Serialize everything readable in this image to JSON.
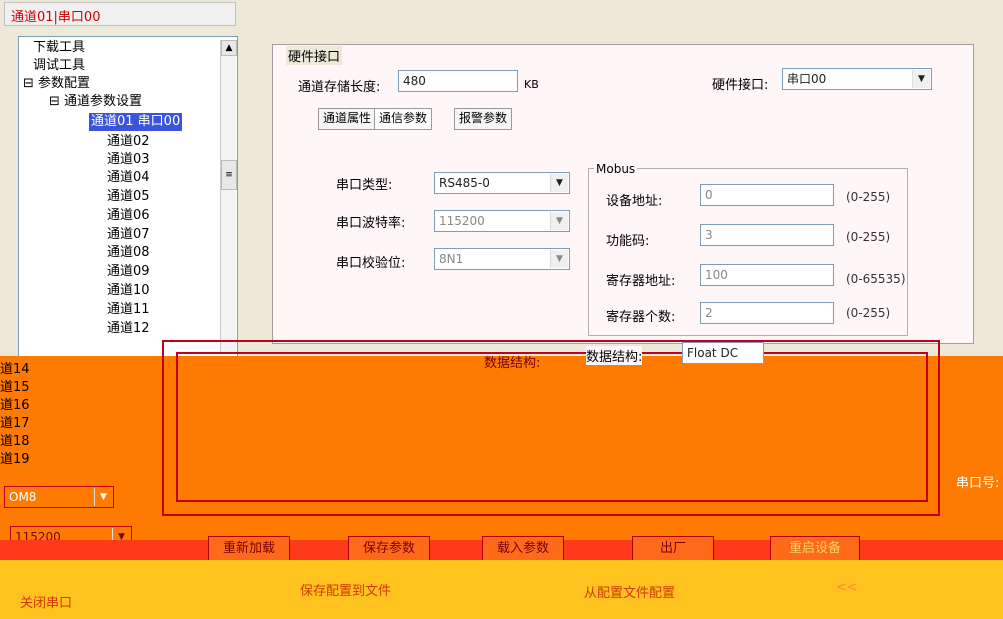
{
  "channel_title": "通道01|串口00",
  "tree": {
    "items": [
      "下载工具",
      "调试工具",
      "参数配置",
      "通道参数设置",
      "通道01 串口00",
      "通道02",
      "通道03",
      "通道04",
      "通道05",
      "通道06",
      "通道07",
      "通道08",
      "通道09",
      "通道10",
      "通道11",
      "通道12"
    ]
  },
  "hardware": {
    "group_title": "硬件接口",
    "storage_label": "通道存储长度:",
    "storage_value": "480",
    "storage_unit": "KB",
    "iface_label": "硬件接口:",
    "iface_value": "串口00"
  },
  "tabs": [
    "通道属性",
    "通信参数",
    "报警参数"
  ],
  "serial": {
    "type_label": "串口类型:",
    "type_value": "RS485-0",
    "baud_label": "串口波特率:",
    "baud_value": "115200",
    "parity_label": "串口校验位:",
    "parity_value": "8N1"
  },
  "modbus": {
    "title": "Mobus",
    "addr_label": "设备地址:",
    "addr_value": "0",
    "addr_range": "(0-255)",
    "func_label": "功能码:",
    "func_value": "3",
    "func_range": "(0-255)",
    "reg_addr_label": "寄存器地址:",
    "reg_addr_value": "100",
    "reg_addr_range": "(0-65535)",
    "reg_count_label": "寄存器个数:",
    "reg_count_value": "2",
    "reg_count_range": "(0-255)",
    "data_struct_label": "数据结构:",
    "data_struct_value": "Float DC"
  },
  "lower": {
    "channels": [
      "道14",
      "道15",
      "道16",
      "道17",
      "道18",
      "道19"
    ],
    "com_value": "OM8",
    "baud_value": "115200",
    "data_struct_mid": "数据结构:",
    "port_label": "串口号:"
  },
  "buttons": {
    "reload": "重新加载",
    "save": "保存参数",
    "load": "载入参数",
    "factory": "出厂",
    "restart": "重启设备"
  },
  "footer": {
    "close_port": "关闭串口",
    "save_to_file": "保存配置到文件",
    "from_file": "从配置文件配置",
    "collapse": "<<"
  },
  "colors": {
    "orange": "#ff7a00",
    "yellow": "#ffc21f",
    "red": "#ff3a1a",
    "pink": "#fff6f8"
  }
}
